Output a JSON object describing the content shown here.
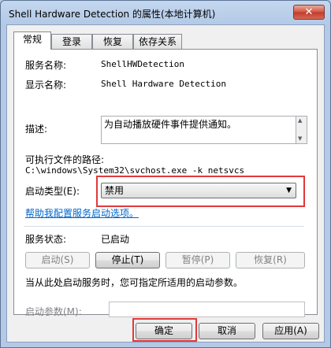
{
  "window": {
    "title": "Shell Hardware Detection 的属性(本地计算机)",
    "close_label": "✕"
  },
  "tabs": [
    "常规",
    "登录",
    "恢复",
    "依存关系"
  ],
  "general": {
    "service_name_label": "服务名称:",
    "service_name": "ShellHWDetection",
    "display_name_label": "显示名称:",
    "display_name": "Shell Hardware Detection",
    "description_label": "描述:",
    "description": "为自动播放硬件事件提供通知。",
    "path_label": "可执行文件的路径:",
    "path": "C:\\windows\\System32\\svchost.exe -k netsvcs",
    "startup_type_label": "启动类型(E):",
    "startup_type_value": "禁用",
    "help_link": "帮助我配置服务启动选项。",
    "status_label": "服务状态:",
    "status_value": "已启动",
    "start_button": "启动(S)",
    "stop_button": "停止(T)",
    "pause_button": "暂停(P)",
    "resume_button": "恢复(R)",
    "hint": "当从此处启动服务时，您可指定所适用的启动参数。",
    "param_label": "启动参数(M):",
    "param_value": ""
  },
  "footer": {
    "ok_button": "确定",
    "cancel_button": "取消",
    "apply_button": "应用(A)"
  },
  "colors": {
    "highlight": "#e03a3a",
    "link": "#0066cc"
  }
}
